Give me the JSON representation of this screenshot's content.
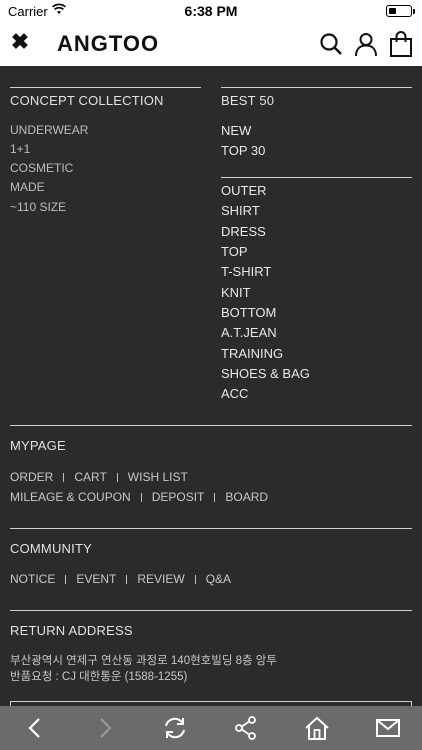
{
  "status": {
    "carrier": "Carrier",
    "time": "6:38 PM",
    "battery_level": 0.35
  },
  "header": {
    "logo": "ANGTOO",
    "icons": [
      "close-icon",
      "search-icon",
      "user-icon",
      "bag-icon"
    ]
  },
  "left_col": {
    "heading": "CONCEPT COLLECTION",
    "items": [
      "UNDERWEAR",
      "1+1",
      "COSMETIC",
      "MADE",
      "~110 SIZE"
    ]
  },
  "right_col": {
    "heading": "BEST 50",
    "top_items": [
      "NEW",
      "TOP 30"
    ],
    "categories": [
      "OUTER",
      "SHIRT",
      "DRESS",
      "TOP",
      "T-SHIRT",
      "KNIT",
      "BOTTOM",
      "A.T.JEAN",
      "TRAINING",
      "SHOES & BAG",
      "ACC"
    ]
  },
  "mypage": {
    "heading": "MYPAGE",
    "row1": [
      "ORDER",
      "CART",
      "WISH LIST"
    ],
    "row2": [
      "MILEAGE & COUPON",
      "DEPOSIT",
      "BOARD"
    ]
  },
  "community": {
    "heading": "COMMUNITY",
    "items": [
      "NOTICE",
      "EVENT",
      "REVIEW",
      "Q&A"
    ]
  },
  "return_address": {
    "heading": "RETURN ADDRESS",
    "line1": "부산광역시 연제구 연산동 과정로 140현호빌딩 8층 앙투",
    "line2": "반품요청 : CJ 대한통운 (1588-1255)"
  },
  "toolbar": {
    "icons": [
      "back-icon",
      "forward-icon",
      "refresh-icon",
      "share-icon",
      "home-icon",
      "mail-icon"
    ]
  }
}
